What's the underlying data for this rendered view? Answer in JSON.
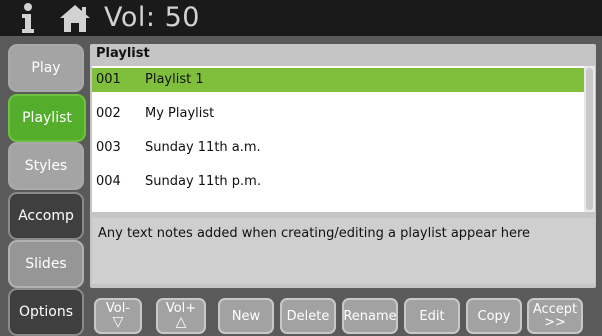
{
  "header": {
    "info_icon": "info-icon",
    "home_icon": "home-icon",
    "volume_label": "Vol: 50"
  },
  "sidebar": {
    "items": [
      {
        "label": "Play"
      },
      {
        "label": "Playlist"
      },
      {
        "label": "Styles"
      },
      {
        "label": "Accomp"
      },
      {
        "label": "Slides"
      },
      {
        "label": "Options"
      }
    ]
  },
  "playlist": {
    "header": "Playlist",
    "rows": [
      {
        "number": "001",
        "name": "Playlist 1"
      },
      {
        "number": "002",
        "name": "My Playlist"
      },
      {
        "number": "003",
        "name": "Sunday 11th a.m."
      },
      {
        "number": "004",
        "name": "Sunday 11th p.m."
      }
    ],
    "notes": "Any text notes added when creating/editing a playlist appear here"
  },
  "toolbar": {
    "vol_down_label": "Vol-",
    "vol_down_symbol": "▽",
    "vol_up_label": "Vol+",
    "vol_up_symbol": "△",
    "new_label": "New",
    "delete_label": "Delete",
    "rename_label": "Rename",
    "edit_label": "Edit",
    "copy_label": "Copy",
    "accept_label": "Accept",
    "accept_symbol": ">>"
  },
  "colors": {
    "accent_green": "#54ae2b",
    "selected_row": "#7fbf3c"
  }
}
